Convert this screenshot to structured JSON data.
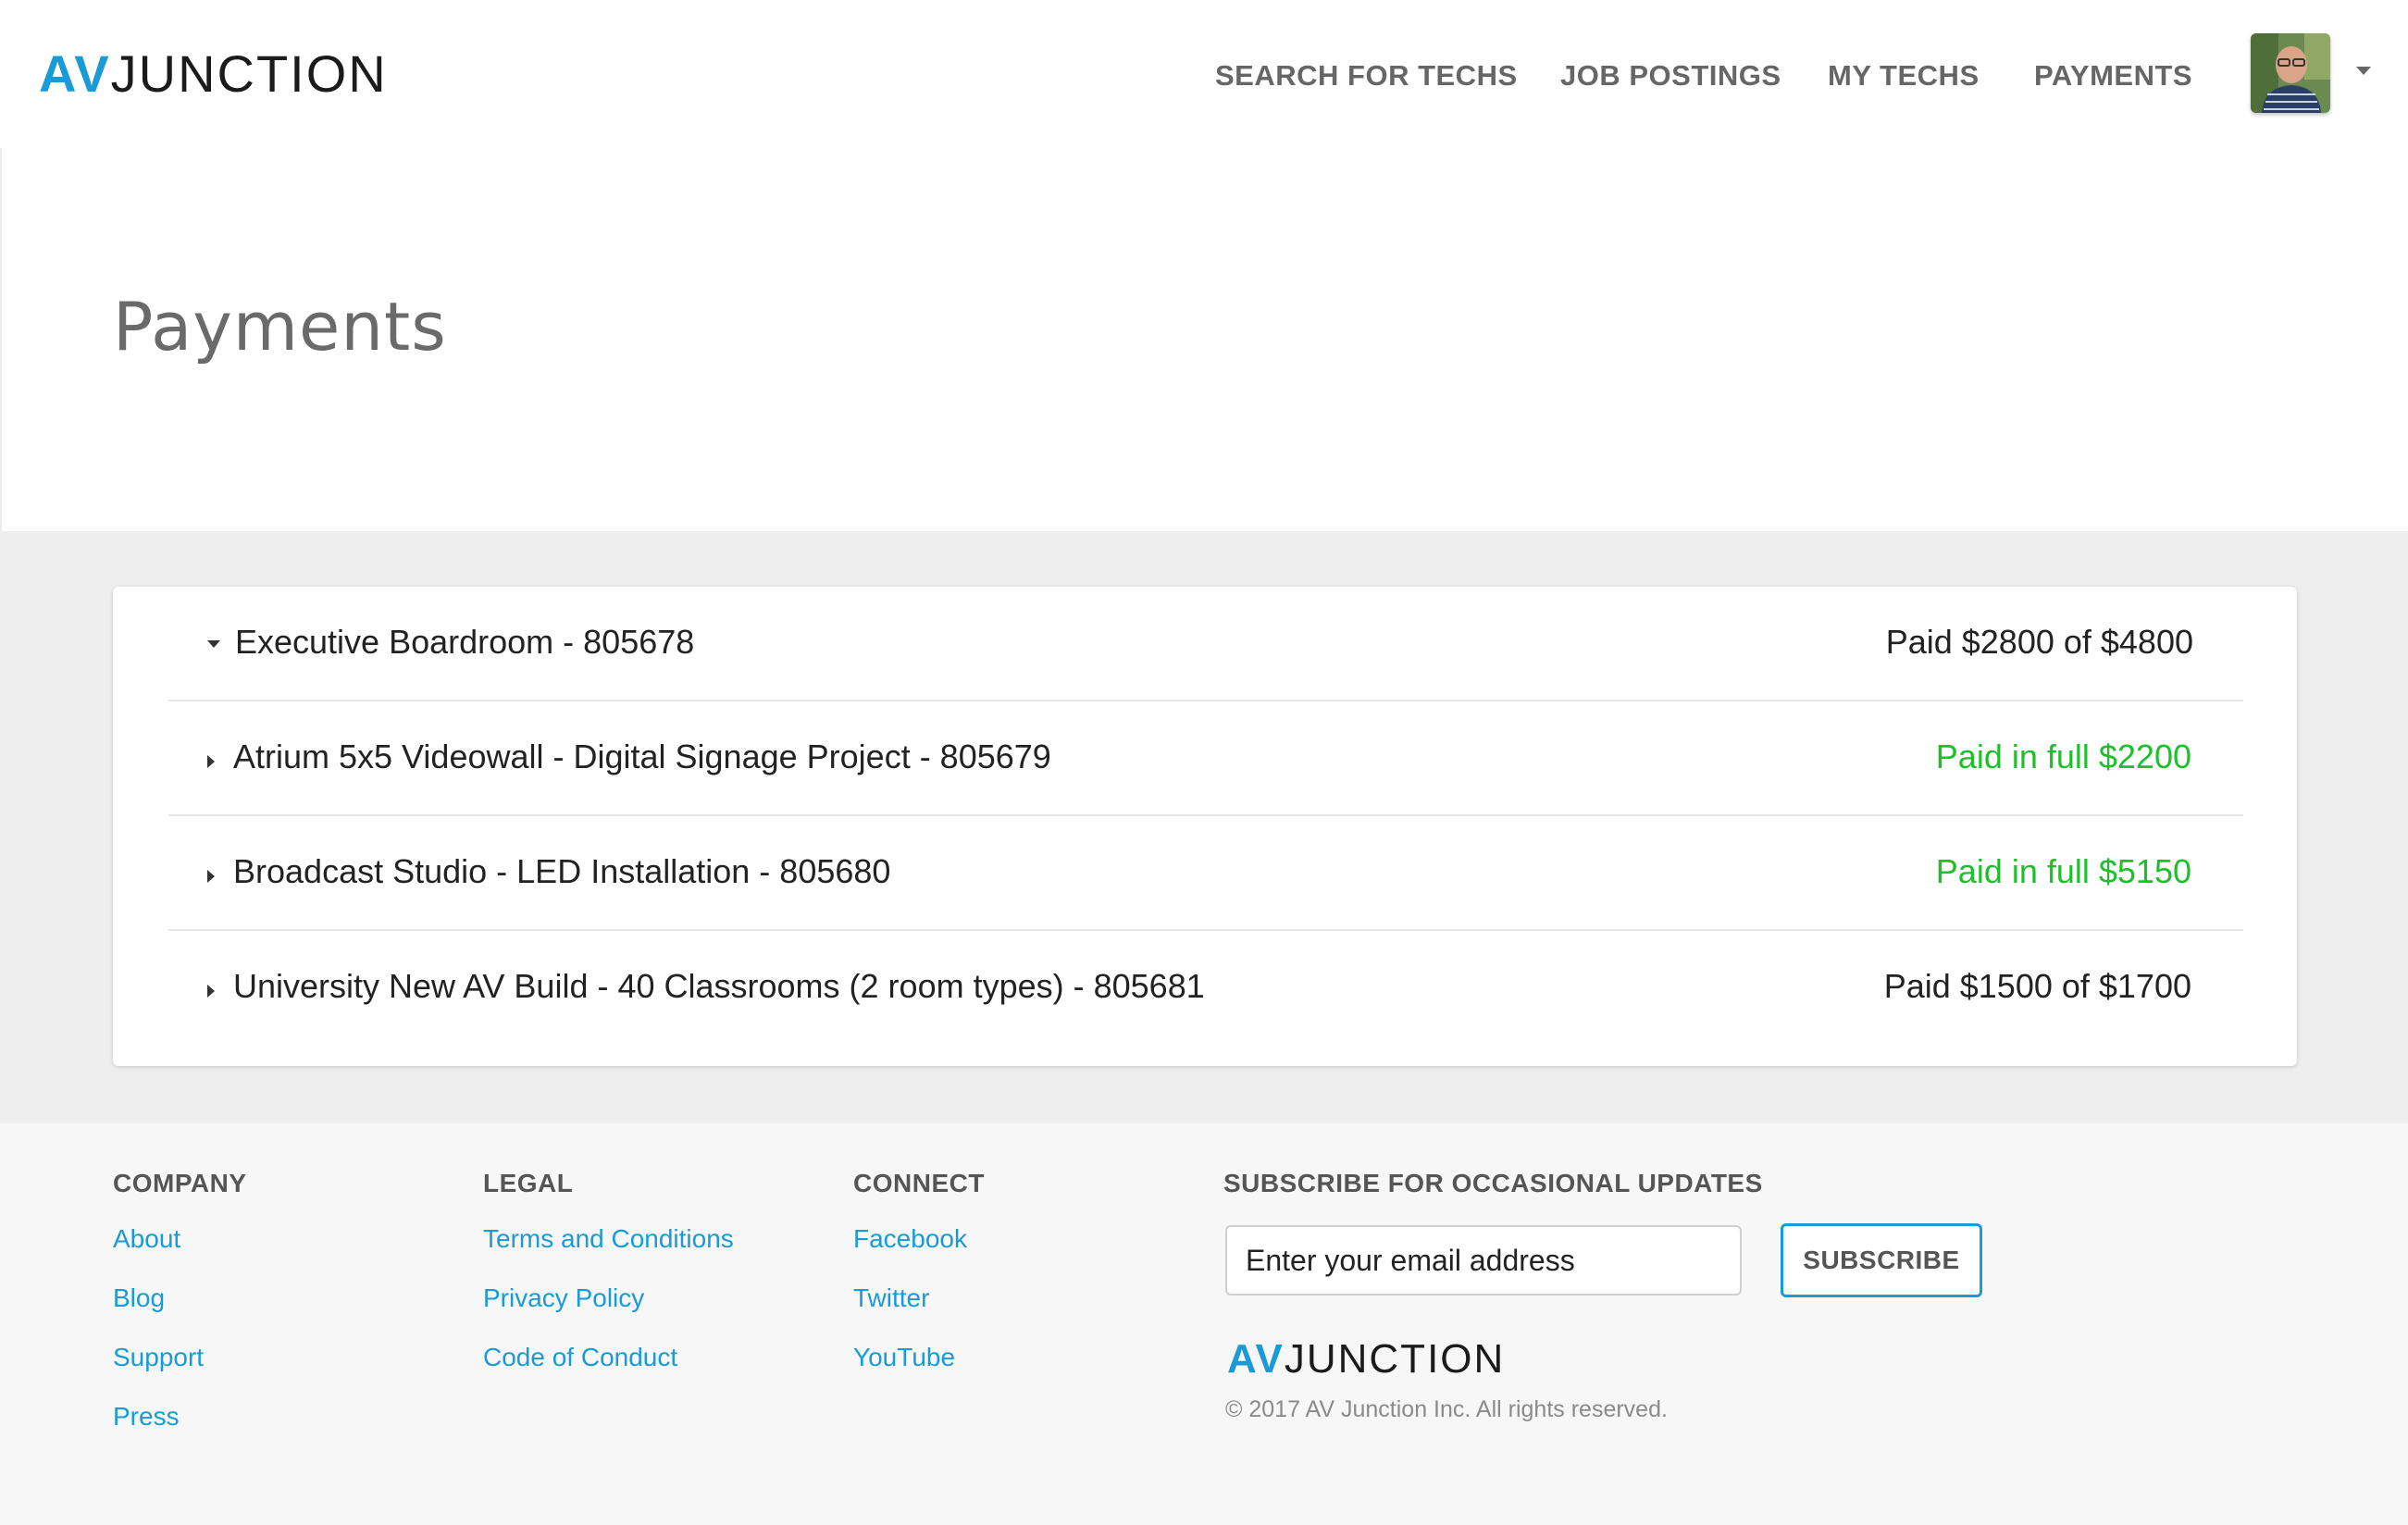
{
  "brand": {
    "logo_accent": "AV",
    "logo_rest": "JUNCTION",
    "accent_color": "#1a9ad6"
  },
  "nav": {
    "items": [
      {
        "label": "SEARCH FOR TECHS"
      },
      {
        "label": "JOB POSTINGS"
      },
      {
        "label": "MY TECHS"
      },
      {
        "label": "PAYMENTS"
      }
    ],
    "avatar_icon": "user-avatar",
    "dropdown_icon": "caret-down-icon"
  },
  "page": {
    "title": "Payments"
  },
  "payments": [
    {
      "title": "Executive Boardroom - 805678",
      "status": "Paid $2800 of $4800",
      "paid_in_full": false,
      "expanded": true
    },
    {
      "title": "Atrium 5x5 Videowall - Digital Signage Project - 805679",
      "status": "Paid in full $2200",
      "paid_in_full": true,
      "expanded": false
    },
    {
      "title": "Broadcast Studio - LED Installation - 805680",
      "status": "Paid in full $5150",
      "paid_in_full": true,
      "expanded": false
    },
    {
      "title": "University New AV Build - 40 Classrooms (2 room types) - 805681",
      "status": "Paid $1500 of $1700",
      "paid_in_full": false,
      "expanded": false
    }
  ],
  "status_colors": {
    "full": "#1fbf2c",
    "partial": "#222222"
  },
  "footer": {
    "company": {
      "heading": "COMPANY",
      "links": [
        "About",
        "Blog",
        "Support",
        "Press"
      ]
    },
    "legal": {
      "heading": "LEGAL",
      "links": [
        "Terms and Conditions",
        "Privacy Policy",
        "Code of Conduct"
      ]
    },
    "connect": {
      "heading": "CONNECT",
      "links": [
        "Facebook",
        "Twitter",
        "YouTube"
      ]
    },
    "subscribe": {
      "heading": "SUBSCRIBE FOR OCCASIONAL UPDATES",
      "placeholder": "Enter your email address",
      "button_label": "SUBSCRIBE"
    },
    "logo_accent": "AV",
    "logo_rest": "JUNCTION",
    "copyright": "© 2017 AV Junction Inc. All rights reserved."
  }
}
